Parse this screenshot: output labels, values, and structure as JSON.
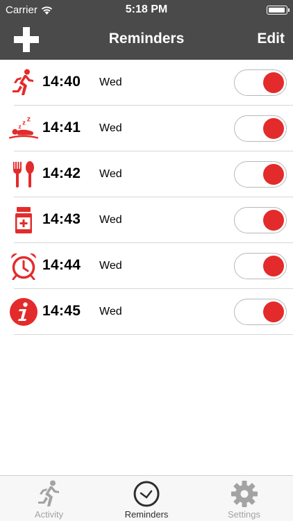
{
  "status_bar": {
    "carrier": "Carrier",
    "time": "5:18 PM"
  },
  "nav": {
    "title": "Reminders",
    "edit_label": "Edit"
  },
  "reminders": [
    {
      "icon": "running-icon",
      "time": "14:40",
      "day": "Wed",
      "enabled": true
    },
    {
      "icon": "sleep-icon",
      "time": "14:41",
      "day": "Wed",
      "enabled": true
    },
    {
      "icon": "fork-spoon-icon",
      "time": "14:42",
      "day": "Wed",
      "enabled": true
    },
    {
      "icon": "medicine-icon",
      "time": "14:43",
      "day": "Wed",
      "enabled": true
    },
    {
      "icon": "alarm-clock-icon",
      "time": "14:44",
      "day": "Wed",
      "enabled": true
    },
    {
      "icon": "info-icon",
      "time": "14:45",
      "day": "Wed",
      "enabled": true
    }
  ],
  "tabs": [
    {
      "label": "Activity",
      "icon": "activity-icon",
      "active": false
    },
    {
      "label": "Reminders",
      "icon": "reminders-clock-icon",
      "active": true
    },
    {
      "label": "Settings",
      "icon": "gear-icon",
      "active": false
    }
  ],
  "colors": {
    "accent": "#e32b2b",
    "bar": "#4a4a4a",
    "tab_active": "#2e2e2e",
    "tab_inactive": "#a3a3a3"
  }
}
